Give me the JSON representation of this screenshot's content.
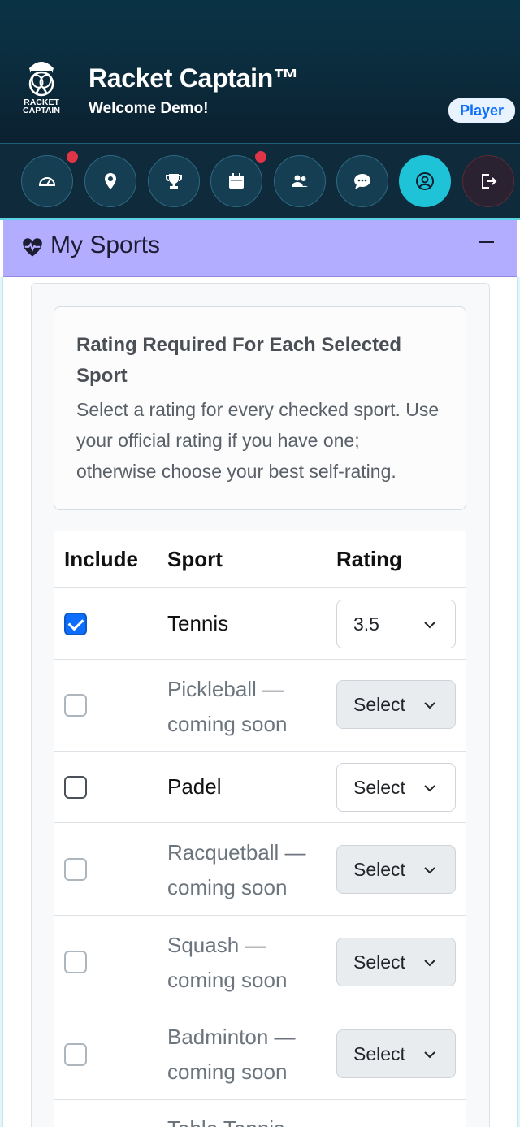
{
  "header": {
    "logo_text_line1": "RACKET",
    "logo_text_line2": "CAPTAIN",
    "app_title": "Racket Captain™",
    "welcome": "Welcome Demo!",
    "role_badge": "Player"
  },
  "nav": {
    "items": [
      {
        "icon": "dashboard-gauge-icon",
        "notification": true
      },
      {
        "icon": "map-pin-icon",
        "notification": false
      },
      {
        "icon": "trophy-icon",
        "notification": false
      },
      {
        "icon": "calendar-icon",
        "notification": true
      },
      {
        "icon": "users-icon",
        "notification": false
      },
      {
        "icon": "chat-icon",
        "notification": false
      },
      {
        "icon": "profile-icon",
        "notification": false,
        "active": true
      },
      {
        "icon": "logout-icon",
        "notification": false
      }
    ]
  },
  "section": {
    "icon": "heart-pulse-icon",
    "title": "My Sports",
    "collapse_symbol": "minus-icon"
  },
  "notice": {
    "title": "Rating Required For Each Selected Sport",
    "body": "Select a rating for every checked sport. Use your official rating if you have one; otherwise choose your best self-rating."
  },
  "table": {
    "headers": {
      "include": "Include",
      "sport": "Sport",
      "rating": "Rating"
    },
    "rows": [
      {
        "checked": true,
        "enabled": true,
        "sport_line1": "Tennis",
        "sport_line2": "",
        "rating": "3.5"
      },
      {
        "checked": false,
        "enabled": false,
        "sport_line1": "Pickleball —",
        "sport_line2": "coming soon",
        "rating": "Select"
      },
      {
        "checked": false,
        "enabled": true,
        "sport_line1": "Padel",
        "sport_line2": "",
        "rating": "Select"
      },
      {
        "checked": false,
        "enabled": false,
        "sport_line1": "Racquetball —",
        "sport_line2": "coming soon",
        "rating": "Select"
      },
      {
        "checked": false,
        "enabled": false,
        "sport_line1": "Squash —",
        "sport_line2": "coming soon",
        "rating": "Select"
      },
      {
        "checked": false,
        "enabled": false,
        "sport_line1": "Badminton —",
        "sport_line2": "coming soon",
        "rating": "Select"
      },
      {
        "checked": false,
        "enabled": false,
        "sport_line1": "Table Tennis",
        "sport_line2": "",
        "rating": ""
      }
    ]
  },
  "colors": {
    "header_bg": "#0b2e3f",
    "accent_cyan": "#1fc3d7",
    "section_header_bg": "#b2adff",
    "checkbox_checked": "#0d6efd",
    "notification_dot": "#e03546",
    "badge_text": "#0d6efd"
  }
}
